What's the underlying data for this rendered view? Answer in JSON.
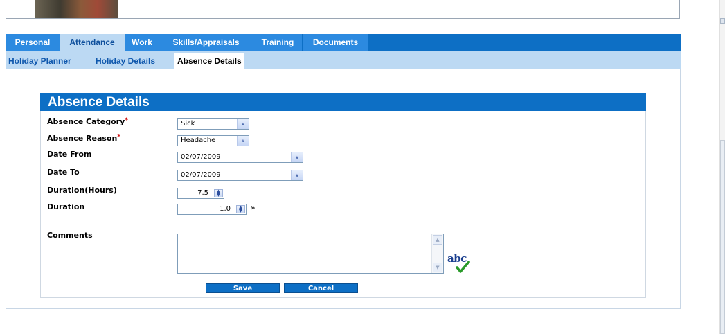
{
  "tabs": [
    {
      "label": "Personal"
    },
    {
      "label": "Attendance"
    },
    {
      "label": "Work"
    },
    {
      "label": "Skills/Appraisals"
    },
    {
      "label": "Training"
    },
    {
      "label": "Documents"
    }
  ],
  "active_tab": "Attendance",
  "subtabs": [
    {
      "label": "Holiday Planner"
    },
    {
      "label": "Holiday Details"
    },
    {
      "label": "Absence Details"
    }
  ],
  "active_subtab": "Absence Details",
  "form": {
    "title": "Absence Details",
    "absence_category": {
      "label": "Absence Category",
      "required_mark": "*",
      "value": "Sick"
    },
    "absence_reason": {
      "label": "Absence Reason",
      "required_mark": "*",
      "value": "Headache"
    },
    "date_from": {
      "label": "Date From",
      "value": "02/07/2009"
    },
    "date_to": {
      "label": "Date To",
      "value": "02/07/2009"
    },
    "duration_hours": {
      "label": "Duration(Hours)",
      "value": "7.5"
    },
    "duration": {
      "label": "Duration",
      "value": "1.0"
    },
    "comments": {
      "label": "Comments",
      "value": ""
    },
    "spellcheck_text": "abc",
    "save_label": "Save",
    "cancel_label": "Cancel"
  },
  "colors": {
    "tab_blue": "#0d6fc5",
    "subtab_bg": "#bcd9f3",
    "required": "#d01010",
    "spellcheck_tick": "#2a9a2a"
  }
}
